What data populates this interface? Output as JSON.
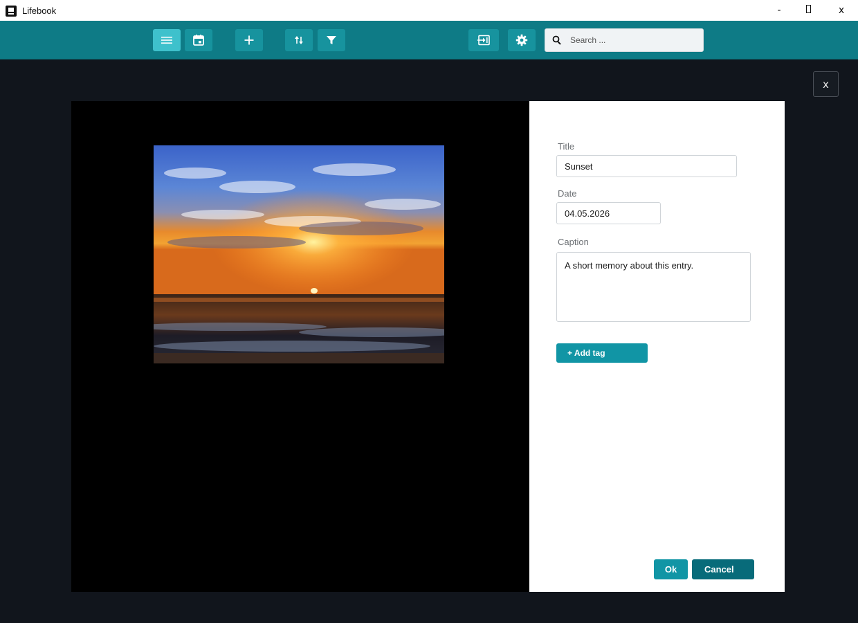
{
  "window": {
    "title": "Lifebook",
    "minimize_label": "-",
    "close_label": "x"
  },
  "toolbar": {
    "buttons": [
      {
        "icon": "list-icon",
        "active": true
      },
      {
        "icon": "calendar-icon",
        "active": false
      },
      {
        "icon": "plus-icon",
        "active": false
      },
      {
        "icon": "sort-icon",
        "active": false
      },
      {
        "icon": "filter-icon",
        "active": false
      },
      {
        "icon": "import-icon",
        "active": false
      },
      {
        "icon": "gear-icon",
        "active": false
      }
    ],
    "search": {
      "icon": "search-icon",
      "placeholder": "Search ...",
      "value": ""
    }
  },
  "modal": {
    "close_label": "x",
    "image": {
      "description_icon": "photo-sunset"
    },
    "form": {
      "title_label": "Title",
      "title_value": "Sunset",
      "date_label": "Date",
      "date_value": "04.05.2026",
      "caption_label": "Caption",
      "caption_value": "A short memory about this entry.",
      "add_tag_label": "+ Add tag",
      "ok_label": "Ok",
      "cancel_label": "Cancel"
    }
  },
  "colors": {
    "toolbar": "#0e7b86",
    "button": "#17939e",
    "button_active": "#3ec1cc",
    "accent": "#1195a5",
    "cancel": "#086b7a",
    "background": "#11151c"
  }
}
